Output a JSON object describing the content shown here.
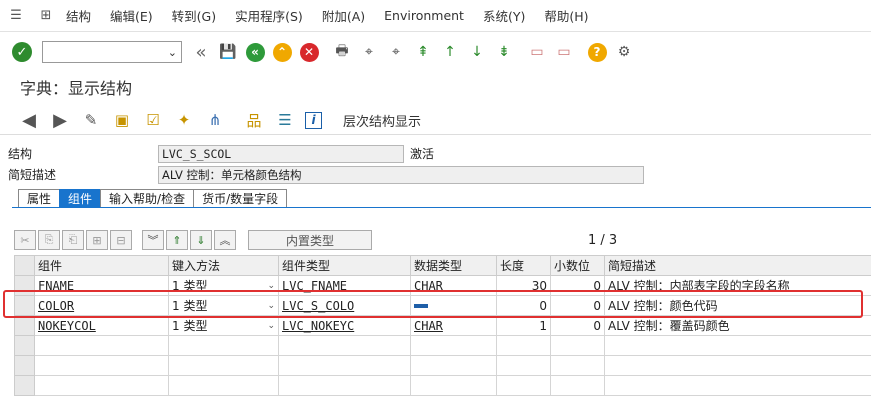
{
  "menubar": {
    "items": [
      "结构",
      "编辑(E)",
      "转到(G)",
      "实用程序(S)",
      "附加(A)",
      "Environment",
      "系统(Y)",
      "帮助(H)"
    ]
  },
  "toolbar": {
    "command_field_value": ""
  },
  "title": "字典：显示结构",
  "app_toolbar": {
    "hierarchy_label": "层次结构显示"
  },
  "fields": {
    "structure_label": "结构",
    "structure_value": "LVC_S_SCOL",
    "structure_status": "激活",
    "short_desc_label": "简短描述",
    "short_desc_value": "ALV 控制：单元格颜色结构"
  },
  "tabs": [
    "属性",
    "组件",
    "输入帮助/检查",
    "货币/数量字段"
  ],
  "active_tab": "组件",
  "grid_toolbar": {
    "builtin_type_label": "内置类型"
  },
  "pager": "1 / 3",
  "table": {
    "columns": [
      "组件",
      "键入方法",
      "组件类型",
      "数据类型",
      "长度",
      "小数位",
      "简短描述"
    ],
    "rows": [
      {
        "component": "FNAME",
        "typing": "1 类型",
        "comp_type": "LVC_FNAME",
        "data_type": "CHAR",
        "length": "30",
        "decimals": "0",
        "desc": "ALV 控制：内部表字段的字段名称"
      },
      {
        "component": "COLOR",
        "typing": "1 类型",
        "comp_type": "LVC_S_COLO",
        "data_type": "",
        "length": "0",
        "decimals": "0",
        "desc": "ALV 控制：颜色代码"
      },
      {
        "component": "NOKEYCOL",
        "typing": "1 类型",
        "comp_type": "LVC_NOKEYC",
        "data_type": "CHAR",
        "length": "1",
        "decimals": "0",
        "desc": "ALV 控制：覆盖码颜色"
      }
    ]
  },
  "colors": {
    "accent_blue": "#1874cd",
    "highlight_red": "#e03030"
  }
}
